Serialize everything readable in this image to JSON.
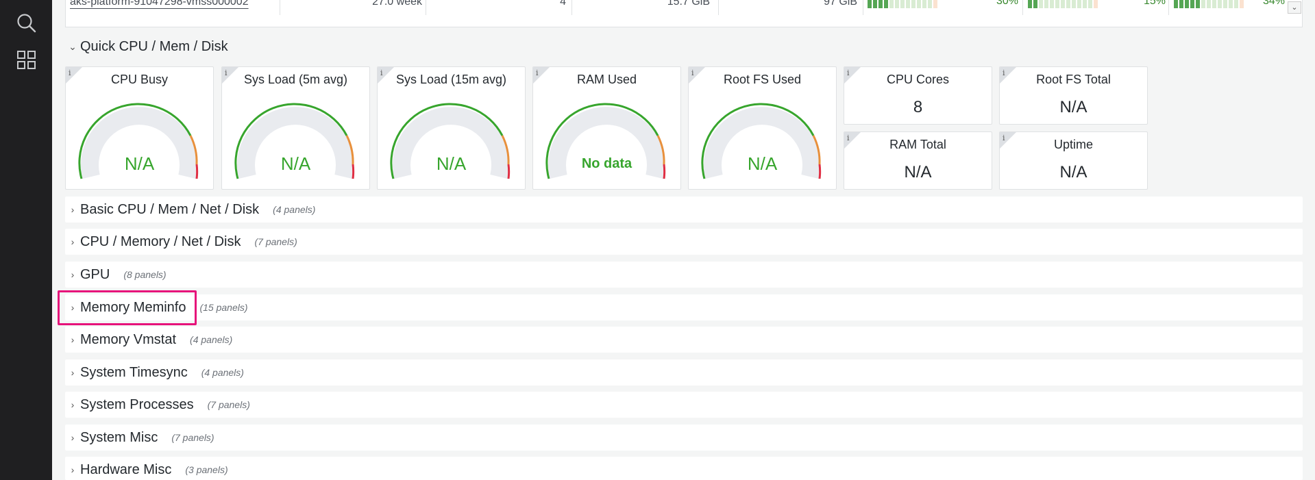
{
  "sidebar": {
    "icons": [
      "search-icon",
      "dashboards-grid-icon"
    ]
  },
  "top_row": {
    "name": "aks-platform-91047298-vmss000002",
    "uptime": "27.0 week",
    "cpus": "4",
    "ram": "15.7 GiB",
    "disk": "97 GiB",
    "cpu_pct": "30%",
    "mem_pct": "15%",
    "disk_pct": "34%",
    "scroll_glyph": "⌄"
  },
  "quick_section": {
    "chevron": "⌄",
    "title": "Quick CPU / Mem / Disk"
  },
  "panel_info_glyph": "i",
  "gauges": [
    {
      "title": "CPU Busy",
      "value": "N/A"
    },
    {
      "title": "Sys Load (5m avg)",
      "value": "N/A"
    },
    {
      "title": "Sys Load (15m avg)",
      "value": "N/A"
    },
    {
      "title": "RAM Used",
      "value": "No data"
    },
    {
      "title": "Root FS Used",
      "value": "N/A"
    }
  ],
  "stats": [
    {
      "title": "CPU Cores",
      "value": "8"
    },
    {
      "title": "Root FS Total",
      "value": "N/A"
    },
    {
      "title": "RAM Total",
      "value": "N/A"
    },
    {
      "title": "Uptime",
      "value": "N/A"
    }
  ],
  "rows": [
    {
      "label": "Basic CPU / Mem / Net / Disk",
      "count": "(4 panels)"
    },
    {
      "label": "CPU / Memory / Net / Disk",
      "count": "(7 panels)"
    },
    {
      "label": "GPU",
      "count": "(8 panels)"
    },
    {
      "label": "Memory Meminfo",
      "count": "(15 panels)"
    },
    {
      "label": "Memory Vmstat",
      "count": "(4 panels)"
    },
    {
      "label": "System Timesync",
      "count": "(4 panels)"
    },
    {
      "label": "System Processes",
      "count": "(7 panels)"
    },
    {
      "label": "System Misc",
      "count": "(7 panels)"
    },
    {
      "label": "Hardware Misc",
      "count": "(3 panels)"
    }
  ],
  "row_chevron": "›",
  "colors": {
    "gauge_green": "#37a52d",
    "gauge_orange": "#e8903c",
    "gauge_red": "#e02f44",
    "highlight": "#e6127a"
  }
}
